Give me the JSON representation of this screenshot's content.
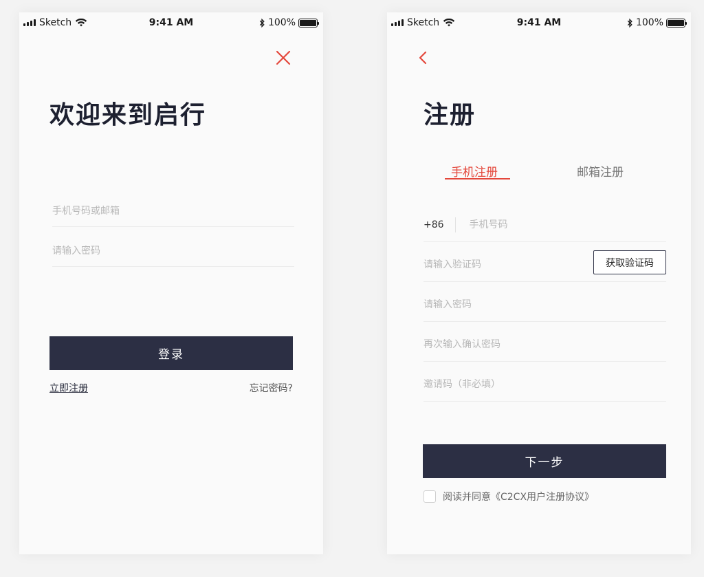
{
  "status_bar": {
    "carrier": "Sketch",
    "time": "9:41 AM",
    "battery": "100%",
    "battery_level": 1.0
  },
  "login": {
    "close_icon": "close-icon",
    "title": "欢迎来到启行",
    "account_placeholder": "手机号码或邮箱",
    "password_placeholder": "请输入密码",
    "login_button": "登录",
    "register_link": "立即注册",
    "forgot_link": "忘记密码?"
  },
  "register": {
    "back_icon": "chevron-left-icon",
    "title": "注册",
    "tabs": [
      {
        "label": "手机注册",
        "active": true
      },
      {
        "label": "邮箱注册",
        "active": false
      }
    ],
    "country_code": "+86",
    "phone_placeholder": "手机号码",
    "code_placeholder": "请输入验证码",
    "get_code_button": "获取验证码",
    "password_placeholder": "请输入密码",
    "confirm_password_placeholder": "再次输入确认密码",
    "invite_placeholder": "邀请码（非必填）",
    "next_button": "下一步",
    "agreement_text": "阅读并同意《C2CX用户注册协议》"
  },
  "colors": {
    "accent": "#e4473b",
    "primary_button": "#2c2f44",
    "background": "#fafafa"
  }
}
